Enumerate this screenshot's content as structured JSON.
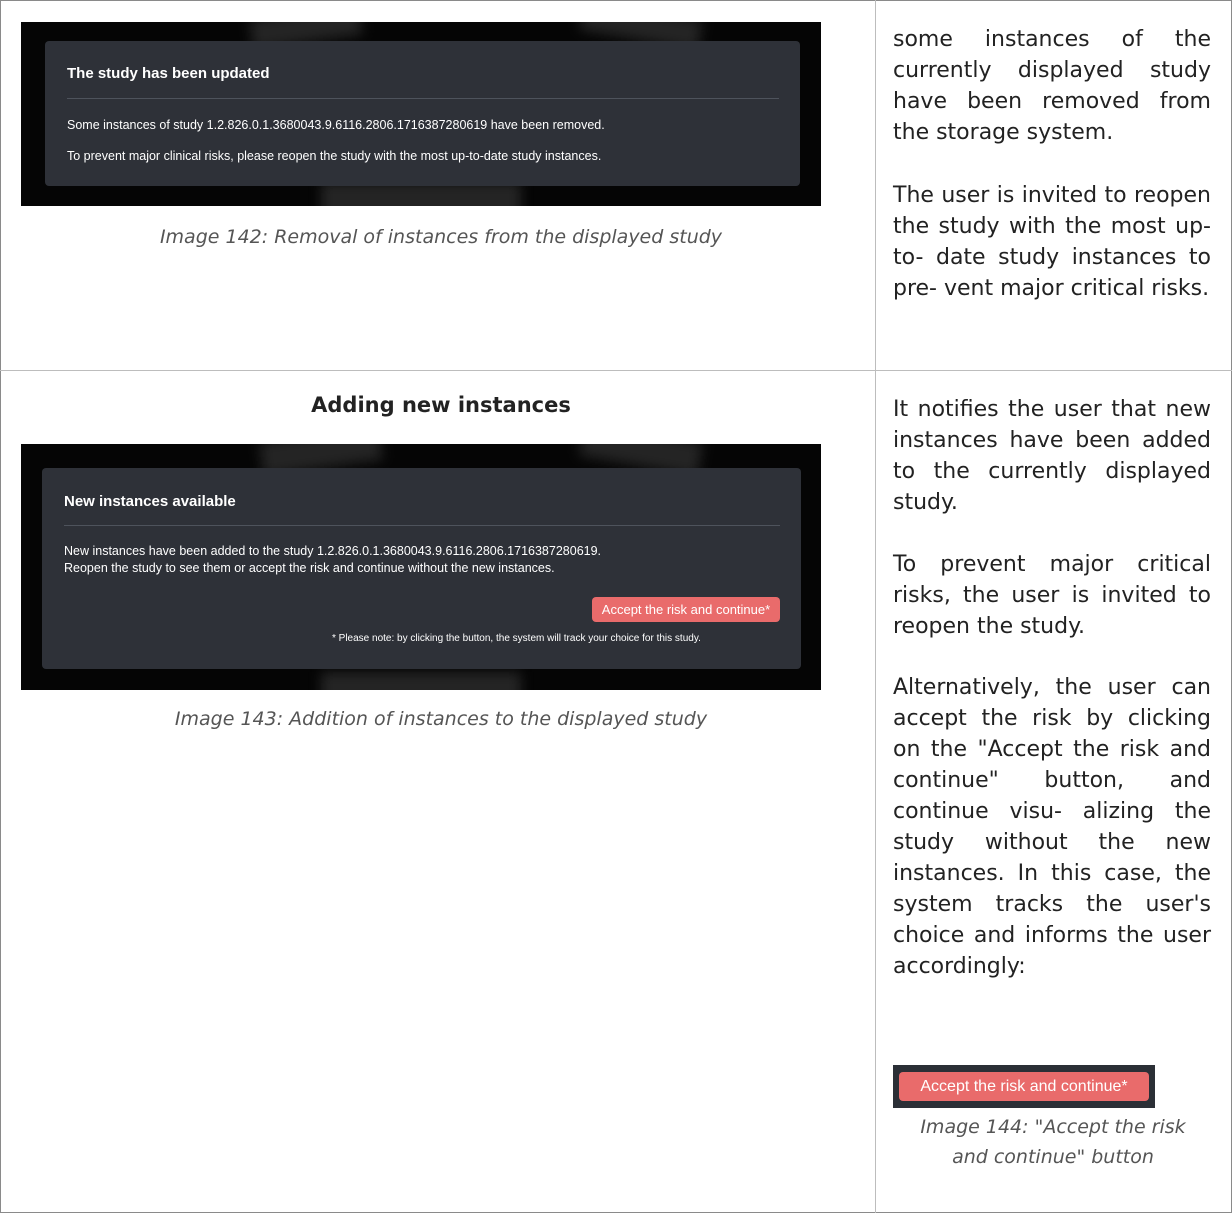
{
  "section_removed": {
    "dialog": {
      "title": "The study has been updated",
      "line1": "Some instances of study 1.2.826.0.1.3680043.9.6116.2806.1716387280619 have been removed.",
      "line2": "To prevent major clinical risks, please reopen the study with the most up-to-date study instances."
    },
    "caption": "Image 142: Removal of instances from the displayed study",
    "paragraphs": [
      "some instances of the currently displayed study have been removed from the storage system.",
      "The user is invited to reopen the study with the most up- to- date study instances to pre- vent major critical risks."
    ]
  },
  "section_added": {
    "heading": "Adding new instances",
    "dialog": {
      "title": "New instances available",
      "line1": "New instances have been added to the study 1.2.826.0.1.3680043.9.6116.2806.1716387280619.",
      "line2": "Reopen the study to see them or accept the risk and continue without the new instances.",
      "button_label": "Accept the risk and continue*",
      "note": "* Please note: by clicking the button, the system will track your choice for this study."
    },
    "caption": "Image 143: Addition of instances to the displayed study",
    "paragraphs": [
      "It notifies the user that new instances have been added to the currently displayed study.",
      "To prevent major critical risks, the user is invited to reopen the study.",
      "Alternatively, the user can accept the risk by clicking on the \"Accept the risk and continue\" button, and continue visu- alizing the study without the new instances. In this case, the system tracks the user's choice and informs the user accordingly:"
    ],
    "button_image_label": "Accept the risk and continue*",
    "button_caption_line1": "Image 144: \"Accept the risk",
    "button_caption_line2": "and continue\" button"
  },
  "colors": {
    "dialog_bg": "#2e3138",
    "accent_button": "#e96b6b",
    "image_bg": "#050505"
  }
}
